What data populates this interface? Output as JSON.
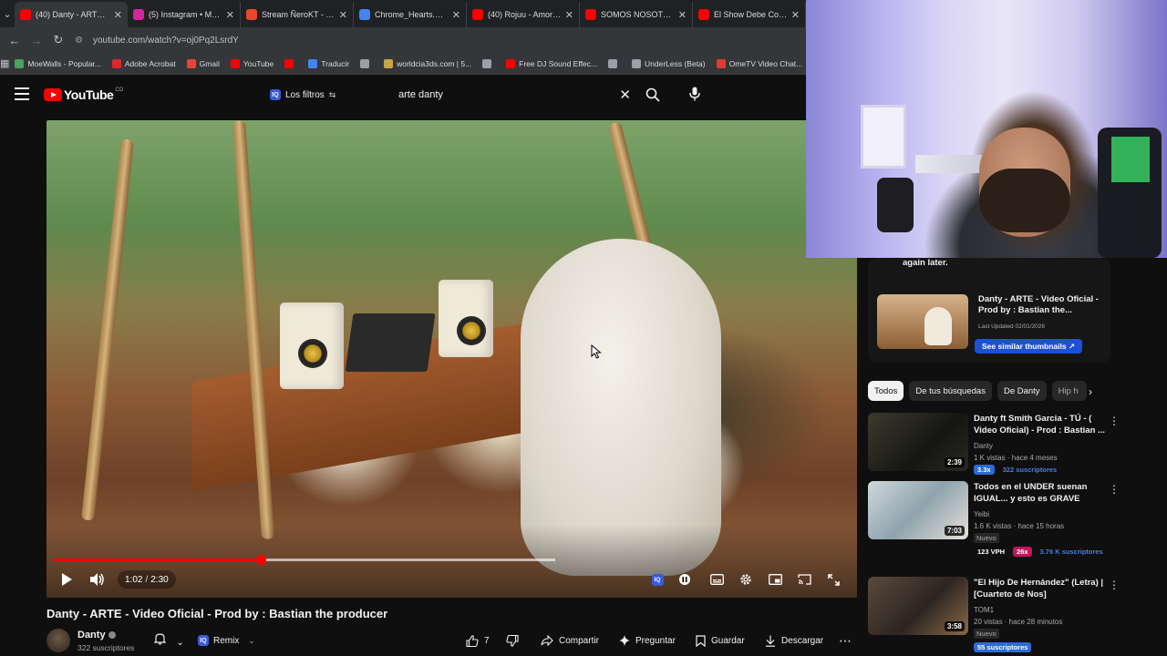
{
  "browser": {
    "tabs": [
      {
        "title": "(40) Danty - ARTE - Vi",
        "favicon_color": "#ff0000",
        "active": true
      },
      {
        "title": "(5) Instagram • Mens",
        "favicon_color": "#d6249f",
        "active": false
      },
      {
        "title": "Stream ÑeroKT - Kan",
        "favicon_color": "#e8492b",
        "active": false
      },
      {
        "title": "Chrome_Hearts.wav",
        "favicon_color": "#4285f4",
        "active": false
      },
      {
        "title": "(40) Rojuu - Amor Ac",
        "favicon_color": "#ff0000",
        "active": false
      },
      {
        "title": "SOMOS NOSOTROS",
        "favicon_color": "#ff0000",
        "active": false
      },
      {
        "title": "El Show Debe Contin",
        "favicon_color": "#ff0000",
        "active": false
      }
    ],
    "url": "youtube.com/watch?v=oj0Pq2LsrdY",
    "bookmarks": [
      {
        "label": "MoeWalls - Popular...",
        "color": "#4aa35a"
      },
      {
        "label": "Adobe Acrobat",
        "color": "#e0252b"
      },
      {
        "label": "Gmail",
        "color": "#ea4335"
      },
      {
        "label": "YouTube",
        "color": "#ff0000"
      },
      {
        "label": "",
        "color": "#ff0000"
      },
      {
        "label": "Traducir",
        "color": "#4285f4"
      },
      {
        "label": "",
        "color": "#9aa0a6"
      },
      {
        "label": "worldcia3ds.com | 5...",
        "color": "#c4a64a"
      },
      {
        "label": "",
        "color": "#9aa0a6"
      },
      {
        "label": "Free DJ Sound Effec...",
        "color": "#ff0000"
      },
      {
        "label": "",
        "color": "#9aa0a6"
      },
      {
        "label": "UnderLess (Beta)",
        "color": "#9aa0a6"
      },
      {
        "label": "OmeTV Video Chat...",
        "color": "#e53935"
      }
    ]
  },
  "youtube": {
    "logo_text": "YouTube",
    "logo_country": "CO",
    "filters_label": "Los filtros",
    "search_query": "arte danty"
  },
  "video": {
    "time_current": "1:02",
    "time_total": "2:30",
    "played_fraction": 0.413,
    "buffered_fraction": 1.0,
    "title": "Danty - ARTE - Video Oficial - Prod by : Bastian the producer",
    "channel": "Danty",
    "subscribers": "322 suscriptores",
    "remix_label": "Remix",
    "likes": "7",
    "share_label": "Compartir",
    "ask_label": "Preguntar",
    "save_label": "Guardar",
    "download_label": "Descargar"
  },
  "sidebar": {
    "error_tail": "again later.",
    "ext_card": {
      "title": "Danty - ARTE - Video Oficial - Prod by : Bastian the...",
      "date": "Last Updated 02/01/2026",
      "button": "See similar thumbnails ↗"
    },
    "chips": [
      "Todos",
      "De tus búsquedas",
      "De Danty",
      "Hip h"
    ],
    "recommendations": [
      {
        "title": "Danty ft Smith Garcia - TÚ - ( Video Oficial) - Prod : Bastian ...",
        "channel": "Danty",
        "meta": "1 K vistas · hace 4 meses",
        "duration": "2:39",
        "watched_fraction": 0.0,
        "tags": [
          {
            "text": "3.3x",
            "color": "#2c6bd6"
          },
          {
            "text": "322 suscriptores",
            "color": "#2c6bd6"
          }
        ],
        "new": ""
      },
      {
        "title": "Todos en el UNDER suenan IGUAL... y esto es GRAVE",
        "channel": "Yeibi",
        "meta": "1.6 K vistas · hace 15 horas",
        "duration": "7:03",
        "watched_fraction": 0.0,
        "new": "Nuevo",
        "tags": [
          {
            "text": "123 VPH",
            "color": "#ffffff"
          },
          {
            "text": "26x",
            "color": "#c2185b"
          },
          {
            "text": "3.76 K suscriptores",
            "color": "#2c6bd6"
          }
        ]
      },
      {
        "title": "\"El Hijo De Hernández\" (Letra) | [Cuarteto de Nos]",
        "channel": "TOM1",
        "meta": "20 vistas · hace 28 minutos",
        "duration": "3:58",
        "watched_fraction": 0.0,
        "new": "Nuevo",
        "tags": [
          {
            "text": "55 suscriptores",
            "color": "#2c6bd6"
          }
        ]
      }
    ]
  },
  "colors": {
    "accent": "#ff0000",
    "background": "#0f0f0f",
    "chip": "#272727",
    "link_blue": "#1d4fd7"
  }
}
